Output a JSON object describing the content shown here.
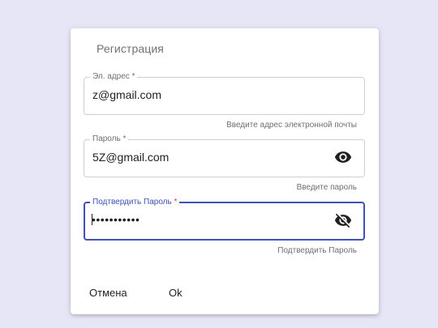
{
  "dialog": {
    "title": "Регистрация"
  },
  "form": {
    "email": {
      "label": "Эл. адрес",
      "required_mark": "*",
      "value": "z@gmail.com",
      "helper": "Введите адрес электронной почты"
    },
    "password": {
      "label": "Пароль",
      "required_mark": "*",
      "value": "5Z@gmail.com",
      "helper": "Введите пароль",
      "toggle_icon": "eye-icon"
    },
    "confirm_password": {
      "label": "Подтвердить Пароль",
      "required_mark": "*",
      "value": "•••••••••••",
      "helper": "Подтвердить Пароль",
      "toggle_icon": "eye-off-icon",
      "focused": true
    }
  },
  "actions": {
    "cancel_label": "Отмена",
    "ok_label": "Ok"
  },
  "colors": {
    "background": "#e6e6f7",
    "accent": "#3f51b5",
    "required": "#e53935"
  }
}
